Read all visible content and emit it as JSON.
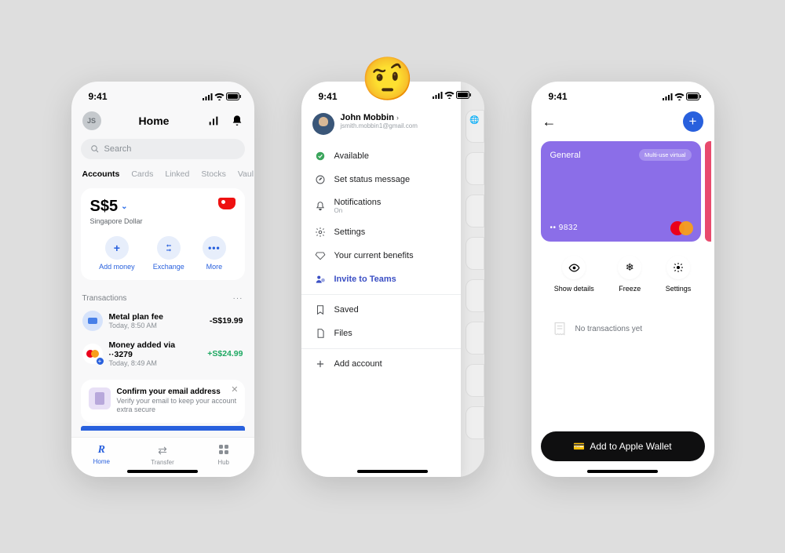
{
  "status": {
    "time": "9:41"
  },
  "screen1": {
    "avatar_initials": "JS",
    "title": "Home",
    "search_placeholder": "Search",
    "tabs": [
      "Accounts",
      "Cards",
      "Linked",
      "Stocks",
      "Vaul"
    ],
    "balance": "S$5",
    "balance_sub": "Singapore Dollar",
    "actions": {
      "add": "Add money",
      "exchange": "Exchange",
      "more": "More"
    },
    "transactions_label": "Transactions",
    "tx": [
      {
        "title": "Metal plan fee",
        "sub": "Today, 8:50 AM",
        "amount": "-S$19.99"
      },
      {
        "title": "Money added via ··3279",
        "sub": "Today, 8:49 AM",
        "amount": "+S$24.99"
      }
    ],
    "banner": {
      "title": "Confirm your email address",
      "sub": "Verify your email to keep your account extra secure"
    },
    "nav": {
      "home": "Home",
      "transfer": "Transfer",
      "hub": "Hub"
    }
  },
  "screen2": {
    "name": "John Mobbin",
    "email": "jsmith.mobbin1@gmail.com",
    "items": {
      "available": "Available",
      "status": "Set status message",
      "notifications": "Notifications",
      "notifications_sub": "On",
      "settings": "Settings",
      "benefits": "Your current benefits",
      "invite": "Invite to Teams",
      "saved": "Saved",
      "files": "Files",
      "add_account": "Add account"
    }
  },
  "screen3": {
    "card_name": "General",
    "card_badge": "Multi-use virtual",
    "card_num": "•• 9832",
    "actions": {
      "show": "Show details",
      "freeze": "Freeze",
      "settings": "Settings"
    },
    "no_tx": "No transactions yet",
    "wallet_btn": "Add to Apple Wallet"
  }
}
